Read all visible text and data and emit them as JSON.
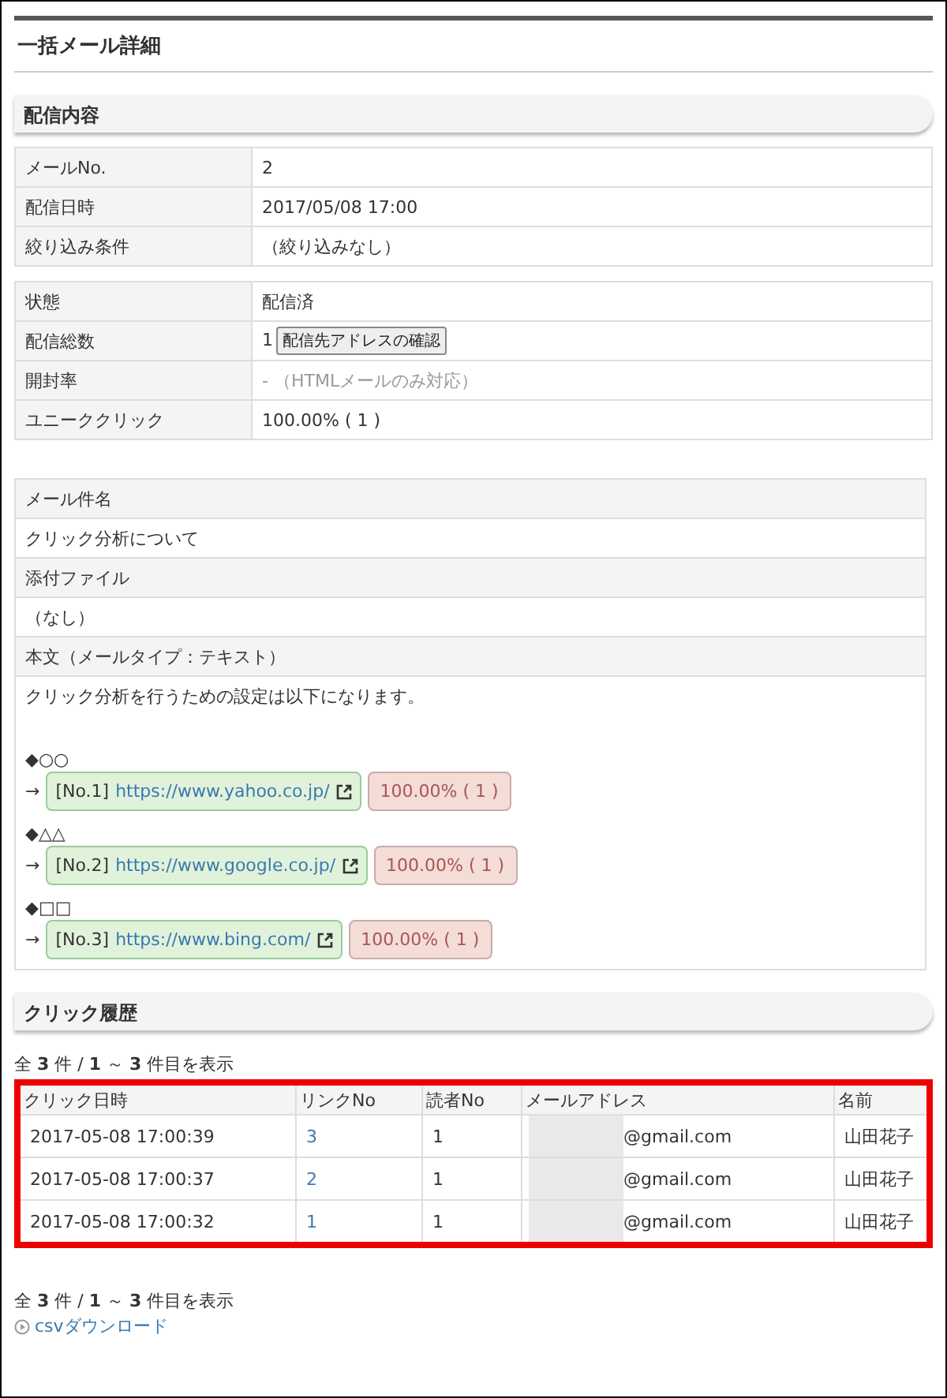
{
  "page_title": "一括メール詳細",
  "delivery": {
    "heading": "配信内容",
    "groups": [
      [
        {
          "label": "メールNo.",
          "value": "2"
        },
        {
          "label": "配信日時",
          "value": "2017/05/08 17:00"
        },
        {
          "label": "絞り込み条件",
          "value": "（絞り込みなし）"
        }
      ],
      [
        {
          "label": "状態",
          "value": "配信済"
        },
        {
          "label": "配信総数",
          "value": "1",
          "button": "配信先アドレスの確認"
        },
        {
          "label": "開封率",
          "value": "- （HTMLメールのみ対応）",
          "muted": true
        },
        {
          "label": "ユニーククリック",
          "value": "100.00% ( 1 )"
        }
      ]
    ],
    "subject_label": "メール件名",
    "subject": "クリック分析について",
    "attachment_label": "添付ファイル",
    "attachment": "（なし）",
    "body_label": "本文（メールタイプ：テキスト）",
    "body_intro": "クリック分析を行うための設定は以下になります。",
    "links": [
      {
        "heading": "◆○○",
        "arrow": "→",
        "number": "[No.1]",
        "url": "https://www.yahoo.co.jp/",
        "rate": "100.00% ( 1 )"
      },
      {
        "heading": "◆△△",
        "arrow": "→",
        "number": "[No.2]",
        "url": "https://www.google.co.jp/",
        "rate": "100.00% ( 1 )"
      },
      {
        "heading": "◆□□",
        "arrow": "→",
        "number": "[No.3]",
        "url": "https://www.bing.com/",
        "rate": "100.00% ( 1 )"
      }
    ]
  },
  "history": {
    "heading": "クリック履歴",
    "count_top": "全 **3** 件 / **1** ～ **3** 件目を表示",
    "columns": [
      "クリック日時",
      "リンクNo",
      "読者No",
      "メールアドレス",
      "名前"
    ],
    "rows": [
      {
        "time": "2017-05-08 17:00:39",
        "link": "3",
        "reader": "1",
        "email": "@gmail.com",
        "redacted": true,
        "name": "山田花子"
      },
      {
        "time": "2017-05-08 17:00:37",
        "link": "2",
        "reader": "1",
        "email": "@gmail.com",
        "redacted": true,
        "name": "山田花子"
      },
      {
        "time": "2017-05-08 17:00:32",
        "link": "1",
        "reader": "1",
        "email": "@gmail.com",
        "redacted": true,
        "name": "山田花子"
      }
    ],
    "count_bottom": "全 **3** 件 / **1** ～ **3** 件目を表示",
    "csv_link": "csvダウンロード"
  }
}
